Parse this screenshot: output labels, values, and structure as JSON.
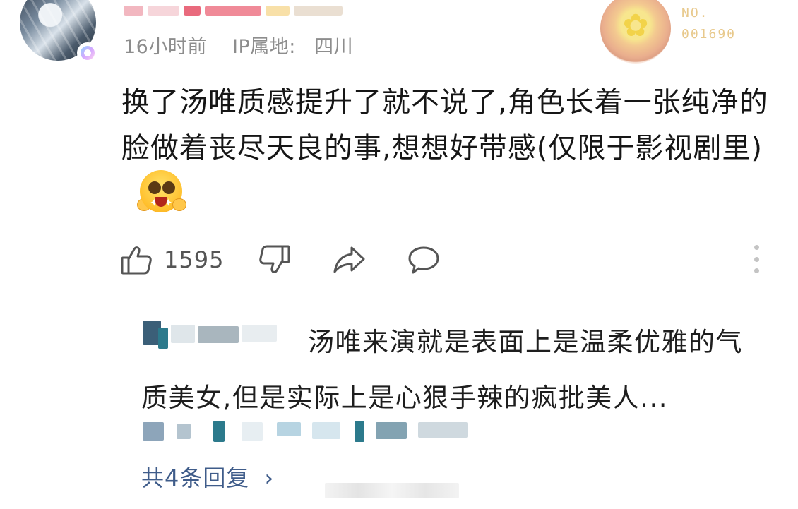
{
  "comment": {
    "meta_time": "16小时前",
    "meta_ip_label": "IP属地:",
    "meta_ip_region": "四川",
    "fan_badge_no": "NO.",
    "fan_badge_number": "001690",
    "text": "换了汤唯质感提升了就不说了,角色长着一张纯净的脸做着丧尽天良的事,想想好带感(仅限于影视剧里)",
    "like_count": "1595"
  },
  "reply": {
    "text": "汤唯来演就是表面上是温柔优雅的气质美女,但是实际上是心狠手辣的疯批美人...",
    "more_replies_label": "共4条回复",
    "chevron": "›"
  },
  "colors": {
    "link_blue": "#3f5c8a",
    "meta_gray": "#8d8d8d",
    "icon_gray": "#555555",
    "blur_teal": "#2c7a8c"
  },
  "icons": {
    "like": "thumbs-up-icon",
    "dislike": "thumbs-down-icon",
    "share": "share-arrow-icon",
    "comment": "comment-bubble-icon",
    "more": "more-vertical-icon"
  }
}
